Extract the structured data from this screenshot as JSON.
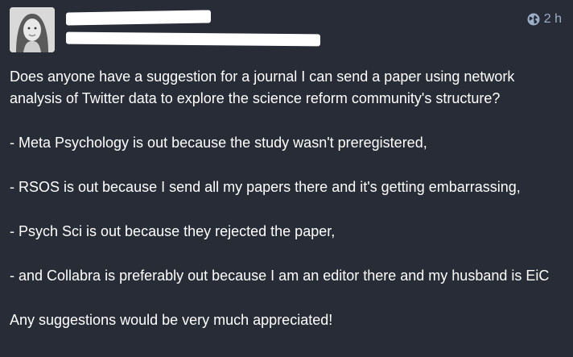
{
  "status": {
    "timestamp": "2 h",
    "visibility_icon": "globe-icon",
    "paragraphs": [
      "Does anyone have a suggestion for a journal I can send a paper using network analysis of Twitter data to explore the science reform community's structure?",
      "- Meta Psychology is out because the study wasn't preregistered,",
      "- RSOS is out because I send all my papers there and it's getting embarrassing,",
      "- Psych Sci is out because they rejected the paper,",
      "- and Collabra is preferably out because I am an editor there and my husband is EiC",
      "Any suggestions would be very much appreciated!"
    ]
  },
  "colors": {
    "background": "#282c37",
    "text": "#ffffff",
    "muted": "#9baec8"
  }
}
